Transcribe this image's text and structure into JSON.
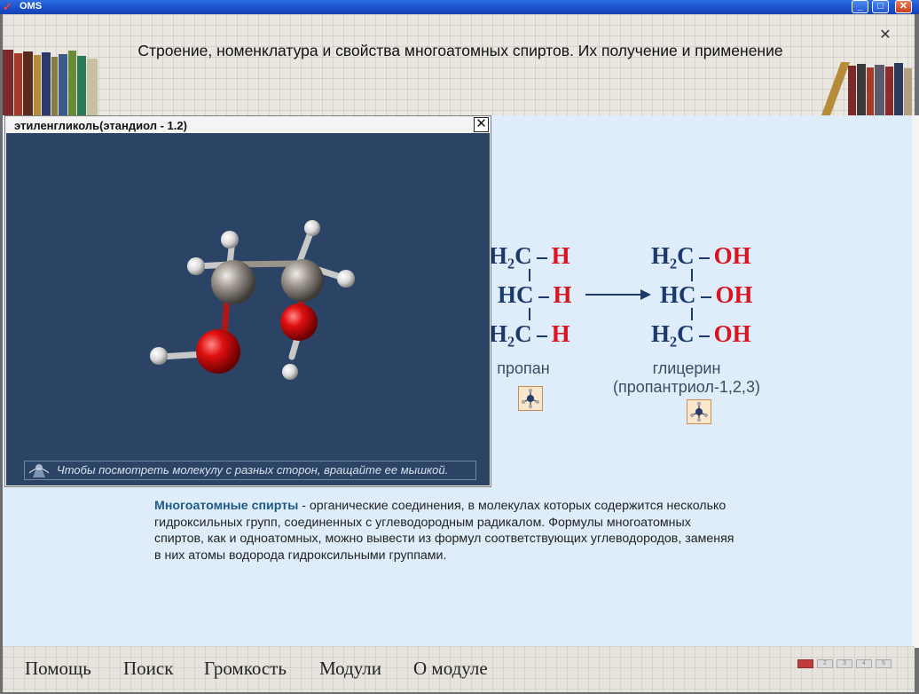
{
  "window": {
    "title": "OMS",
    "minimize": "_",
    "maximize": "□",
    "close": "✕"
  },
  "header": {
    "title": "Строение, номенклатура и свойства многоатомных спиртов. Их получение и применение",
    "close_glyph": "✕"
  },
  "popup": {
    "title": "этиленгликоль(этандиол - 1.2)",
    "close_glyph": "✕",
    "hint": "Чтобы посмотреть молекулу с разных сторон, вращайте ее мышкой.",
    "hint_icon": "rotate-hand-icon"
  },
  "formulas": {
    "propane": {
      "rows": [
        {
          "carbon": "H₂C",
          "substituent": "H"
        },
        {
          "carbon": "HC",
          "substituent": "H"
        },
        {
          "carbon": "H₂C",
          "substituent": "H"
        }
      ],
      "caption": "пропан"
    },
    "glycerol": {
      "rows": [
        {
          "carbon": "H₂C",
          "substituent": "OH"
        },
        {
          "carbon": "HC",
          "substituent": "OH"
        },
        {
          "carbon": "H₂C",
          "substituent": "OH"
        }
      ],
      "caption_line1": "глицерин",
      "caption_line2": "(пропантриол-1,2,3)"
    },
    "colors": {
      "carbon": "#1b3a6b",
      "substituent": "#d8141e"
    }
  },
  "description": {
    "term": "Многоатомные спирты",
    "text": " - органические соединения, в молекулах которых содержится несколько гидроксильных групп, соединенных с углеводородным радикалом. Формулы многоатомных спиртов, как и одноатомных, можно вывести из формул соответствующих углеводородов, заменяя в них атомы водорода гидроксильными группами."
  },
  "menu": {
    "items": [
      "Помощь",
      "Поиск",
      "Громкость",
      "Модули",
      "О модуле"
    ]
  },
  "pager": {
    "pages": [
      "",
      "2",
      "3",
      "4",
      "5"
    ],
    "current": 1
  }
}
